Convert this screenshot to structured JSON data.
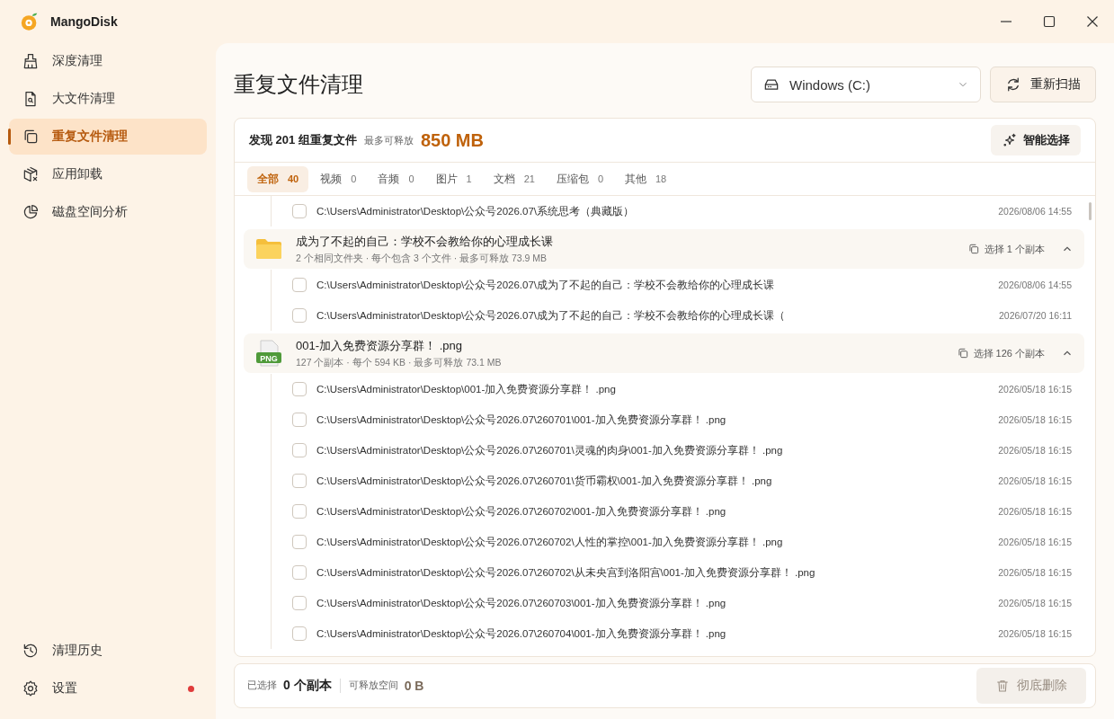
{
  "app": {
    "name": "MangoDisk"
  },
  "sidebar": {
    "items": [
      {
        "label": "深度清理",
        "selected": false
      },
      {
        "label": "大文件清理",
        "selected": false
      },
      {
        "label": "重复文件清理",
        "selected": true
      },
      {
        "label": "应用卸载",
        "selected": false
      },
      {
        "label": "磁盘空间分析",
        "selected": false
      }
    ],
    "bottom_items": [
      {
        "label": "清理历史",
        "notification": false
      },
      {
        "label": "设置",
        "notification": true
      }
    ]
  },
  "page_title": "重复文件清理",
  "drive_select": {
    "value": "Windows (C:)"
  },
  "rescan_button": "重新扫描",
  "summary": {
    "found": "发现 201 组重复文件",
    "free_label": "最多可释放",
    "free_value": "850 MB",
    "smart_button": "智能选择"
  },
  "tabs": [
    {
      "label": "全部",
      "count": "40",
      "selected": true
    },
    {
      "label": "视频",
      "count": "0",
      "selected": false
    },
    {
      "label": "音频",
      "count": "0",
      "selected": false
    },
    {
      "label": "图片",
      "count": "1",
      "selected": false
    },
    {
      "label": "文档",
      "count": "21",
      "selected": false
    },
    {
      "label": "压缩包",
      "count": "0",
      "selected": false
    },
    {
      "label": "其他",
      "count": "18",
      "selected": false
    }
  ],
  "list": [
    {
      "kind": "row",
      "path": "C:\\Users\\Administrator\\Desktop\\公众号2026.07\\系统思考（典藏版）",
      "date": "2026/08/06 14:55",
      "checked": false
    },
    {
      "kind": "folder_group",
      "title": "成为了不起的自己：学校不会教给你的心理成长课",
      "meta": "2 个相同文件夹 · 每个包含 3 个文件 · 最多可释放 73.9 MB",
      "select_label": "选择 1 个副本",
      "expanded": true,
      "children": [
        {
          "path": "C:\\Users\\Administrator\\Desktop\\公众号2026.07\\成为了不起的自己：学校不会教给你的心理成长课",
          "date": "2026/08/06 14:55",
          "checked": false
        },
        {
          "path": "C:\\Users\\Administrator\\Desktop\\公众号2026.07\\成为了不起的自己：学校不会教给你的心理成长课（",
          "date": "2026/07/20 16:11",
          "checked": false
        }
      ]
    },
    {
      "kind": "file_group",
      "file_type": "PNG",
      "title": "001-加入免费资源分享群！ .png",
      "meta": "127 个副本 · 每个 594 KB · 最多可释放 73.1 MB",
      "select_label": "选择 126 个副本",
      "expanded": true,
      "children": [
        {
          "path": "C:\\Users\\Administrator\\Desktop\\001-加入免费资源分享群！ .png",
          "date": "2026/05/18 16:15",
          "checked": false
        },
        {
          "path": "C:\\Users\\Administrator\\Desktop\\公众号2026.07\\260701\\001-加入免费资源分享群！ .png",
          "date": "2026/05/18 16:15",
          "checked": false
        },
        {
          "path": "C:\\Users\\Administrator\\Desktop\\公众号2026.07\\260701\\灵魂的肉身\\001-加入免费资源分享群！ .png",
          "date": "2026/05/18 16:15",
          "checked": false
        },
        {
          "path": "C:\\Users\\Administrator\\Desktop\\公众号2026.07\\260701\\货币霸权\\001-加入免费资源分享群！ .png",
          "date": "2026/05/18 16:15",
          "checked": false
        },
        {
          "path": "C:\\Users\\Administrator\\Desktop\\公众号2026.07\\260702\\001-加入免费资源分享群！ .png",
          "date": "2026/05/18 16:15",
          "checked": false
        },
        {
          "path": "C:\\Users\\Administrator\\Desktop\\公众号2026.07\\260702\\人性的掌控\\001-加入免费资源分享群！ .png",
          "date": "2026/05/18 16:15",
          "checked": false
        },
        {
          "path": "C:\\Users\\Administrator\\Desktop\\公众号2026.07\\260702\\从未央宫到洛阳宫\\001-加入免费资源分享群！ .png",
          "date": "2026/05/18 16:15",
          "checked": false
        },
        {
          "path": "C:\\Users\\Administrator\\Desktop\\公众号2026.07\\260703\\001-加入免费资源分享群！ .png",
          "date": "2026/05/18 16:15",
          "checked": false
        },
        {
          "path": "C:\\Users\\Administrator\\Desktop\\公众号2026.07\\260704\\001-加入免费资源分享群！ .png",
          "date": "2026/05/18 16:15",
          "checked": false
        }
      ]
    }
  ],
  "footer": {
    "selected_label": "已选择",
    "selected_value": "0 个副本",
    "free_label": "可释放空间",
    "free_value": "0 B",
    "delete_button": {
      "label": "彻底删除",
      "disabled": true
    }
  }
}
